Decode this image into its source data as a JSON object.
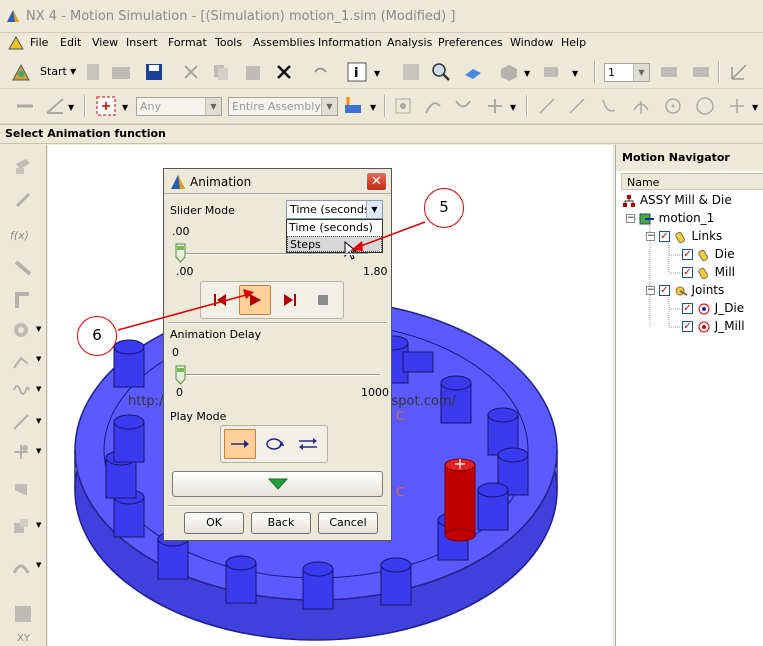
{
  "window": {
    "title": "NX 4 - Motion Simulation - [(Simulation) motion_1.sim (Modified) ]"
  },
  "menu": [
    {
      "label": "File"
    },
    {
      "label": "Edit"
    },
    {
      "label": "View"
    },
    {
      "label": "Insert"
    },
    {
      "label": "Format"
    },
    {
      "label": "Tools"
    },
    {
      "label": "Assemblies"
    },
    {
      "label": "Information"
    },
    {
      "label": "Analysis"
    },
    {
      "label": "Preferences"
    },
    {
      "label": "Window"
    },
    {
      "label": "Help"
    }
  ],
  "toolbar": {
    "start_label": "Start",
    "layer_value": "1",
    "filter_any": "Any",
    "filter_scope": "Entire Assembly"
  },
  "cue_line": "Select Animation function",
  "left_toolbar": {
    "fx_label": "f(x)",
    "xy_label": "XY"
  },
  "graphics": {
    "watermark": "http://mechanical-design-handbook.blogspot.com/",
    "label_c1": "C",
    "label_c2": "C"
  },
  "navigator": {
    "title": "Motion Navigator",
    "column": "Name",
    "items": {
      "root": "ASSY Mill & Die",
      "motion": "motion_1",
      "links": "Links",
      "die": "Die",
      "mill": "Mill",
      "joints": "Joints",
      "j_die": "J_Die",
      "j_mill": "J_Mill"
    }
  },
  "dialog": {
    "title": "Animation",
    "slider_mode_label": "Slider Mode",
    "slider_mode_value": "Time (seconds)",
    "dropdown_options": [
      "Time (seconds)",
      "Steps"
    ],
    "time_value": ".00",
    "time_min": ".00",
    "time_max": "1.80",
    "time_fraction": 0.0,
    "delay_label": "Animation Delay",
    "delay_value": "0",
    "delay_min": "0",
    "delay_max": "1000",
    "delay_fraction": 0.0,
    "play_mode_label": "Play Mode",
    "ok_label": "OK",
    "back_label": "Back",
    "cancel_label": "Cancel"
  },
  "callouts": {
    "c5": "5",
    "c6": "6"
  },
  "colors": {
    "accent_red": "#dd0000",
    "plate_blue": "#5454ff",
    "selected_orange": "#ffd09a"
  }
}
